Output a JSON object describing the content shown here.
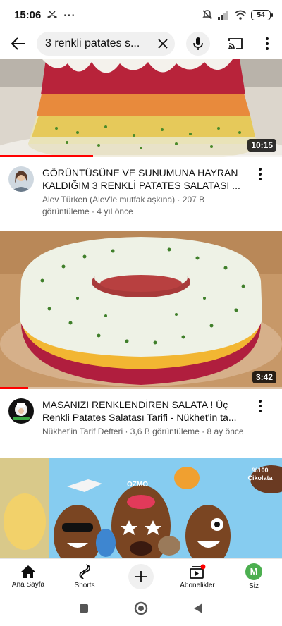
{
  "status_bar": {
    "time": "15:06",
    "battery": "54",
    "icons": [
      "missed-call-icon",
      "dots-icon",
      "mute-icon",
      "signal-icon",
      "wifi-icon",
      "battery-icon"
    ]
  },
  "search": {
    "query": "3 renkli patates s..."
  },
  "videos": [
    {
      "title": "GÖRÜNTÜSÜNE VE SUNUMUNA HAYRAN KALDIĞIM 3 RENKLİ PATATES SALATASI ...",
      "channel_line": "Alev Türken (Alev'le mutfak aşkına) · 207 B görüntüleme · 4 yıl önce",
      "duration": "10:15",
      "progress": 0.33
    },
    {
      "title": "MASANIZI RENKLENDİREN SALATA ! Üç Renkli Patates Salatası Tarifi - Nükhet'in ta...",
      "channel_line": "Nükhet'in Tarif Defteri · 3,6 B görüntüleme · 8 ay önce",
      "duration": "3:42",
      "progress": 0.1
    }
  ],
  "ad_thumbnail": {
    "badge": "%100 Çikolata",
    "brand": "OZMO"
  },
  "bottom_nav": {
    "home": "Ana Sayfa",
    "shorts": "Shorts",
    "subscriptions": "Abonelikler",
    "you": "Siz",
    "avatar_letter": "M"
  },
  "colors": {
    "accent": "#ff0000",
    "avatar": "#4caf50"
  }
}
